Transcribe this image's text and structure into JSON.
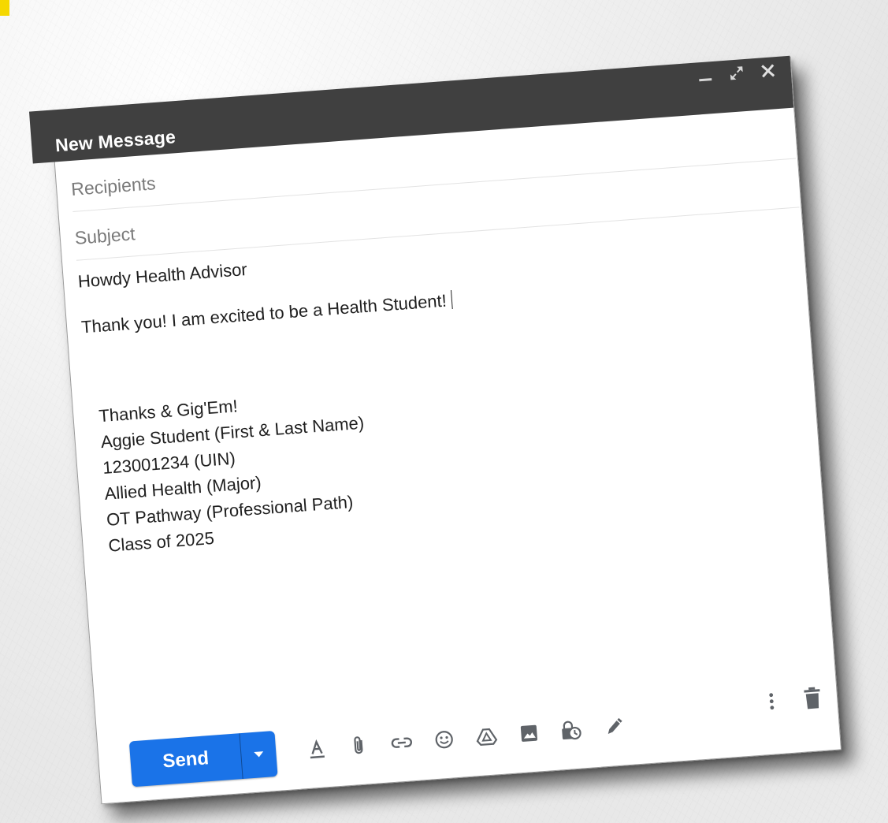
{
  "window": {
    "title": "New Message"
  },
  "fields": {
    "recipients_placeholder": "Recipients",
    "subject_placeholder": "Subject"
  },
  "body": {
    "greeting": "Howdy Health Advisor",
    "message": "Thank you! I am excited to be a Health Student!",
    "signature": [
      "Thanks & Gig'Em!",
      "Aggie Student (First & Last Name)",
      "123001234 (UIN)",
      "Allied Health (Major)",
      "OT Pathway (Professional Path)",
      "Class of 2025"
    ]
  },
  "footer": {
    "send_label": "Send"
  },
  "icons": {
    "title_controls": [
      "minimize-icon",
      "expand-icon",
      "close-icon"
    ],
    "toolbar": [
      "format-text-icon",
      "attach-file-icon",
      "insert-link-icon",
      "emoji-icon",
      "drive-icon",
      "insert-photo-icon",
      "confidential-mode-icon",
      "signature-pen-icon"
    ],
    "right": [
      "more-options-icon",
      "trash-icon"
    ]
  },
  "colors": {
    "titlebar": "#404040",
    "send_button": "#1a73e8",
    "highlight": "#f5d800"
  }
}
